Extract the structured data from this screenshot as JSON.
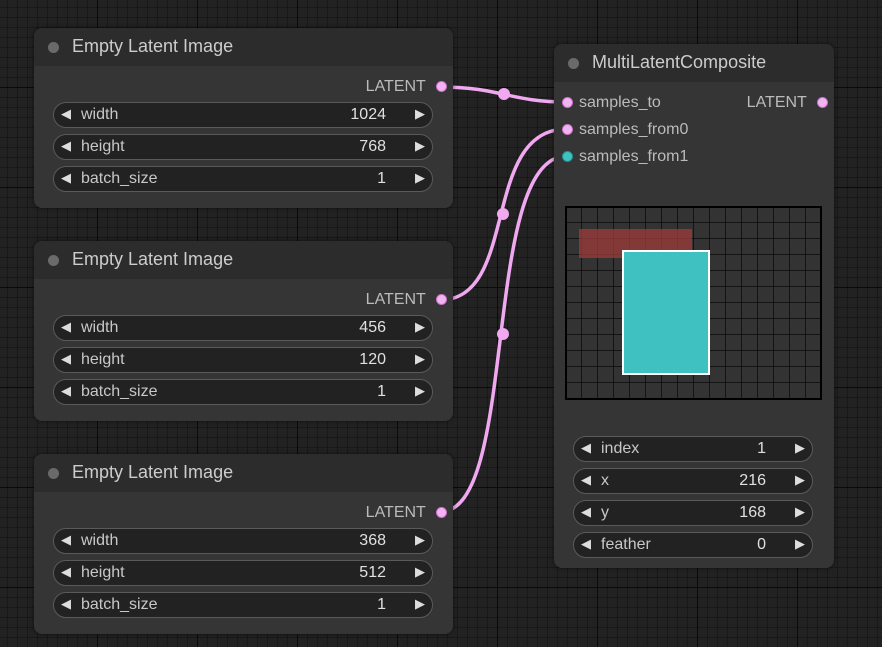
{
  "colors": {
    "latent_link": "#f0a8f0",
    "teal_slot": "#3fc1c1",
    "preview_red": "#a03c3c",
    "node_bg": "#353535"
  },
  "nodes": [
    {
      "title": "Empty Latent Image",
      "output": "LATENT",
      "widgets": [
        {
          "label": "width",
          "value": "1024"
        },
        {
          "label": "height",
          "value": "768"
        },
        {
          "label": "batch_size",
          "value": "1"
        }
      ]
    },
    {
      "title": "Empty Latent Image",
      "output": "LATENT",
      "widgets": [
        {
          "label": "width",
          "value": "456"
        },
        {
          "label": "height",
          "value": "120"
        },
        {
          "label": "batch_size",
          "value": "1"
        }
      ]
    },
    {
      "title": "Empty Latent Image",
      "output": "LATENT",
      "widgets": [
        {
          "label": "width",
          "value": "368"
        },
        {
          "label": "height",
          "value": "512"
        },
        {
          "label": "batch_size",
          "value": "1"
        }
      ]
    }
  ],
  "composite": {
    "title": "MultiLatentComposite",
    "inputs": [
      "samples_to",
      "samples_from0",
      "samples_from1"
    ],
    "output": "LATENT",
    "widgets": [
      {
        "label": "index",
        "value": "1"
      },
      {
        "label": "x",
        "value": "216"
      },
      {
        "label": "y",
        "value": "168"
      },
      {
        "label": "feather",
        "value": "0"
      }
    ]
  },
  "glyphs": {
    "left_arrow": "◀",
    "right_arrow": "▶"
  }
}
